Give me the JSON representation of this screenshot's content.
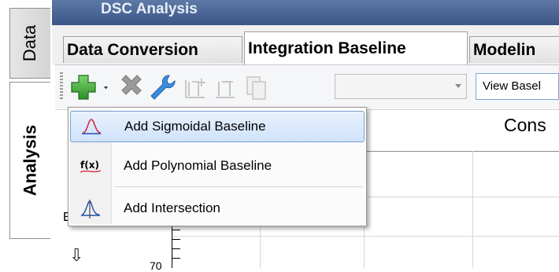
{
  "window": {
    "title": "DSC Analysis"
  },
  "side_tabs": [
    {
      "label": "Data"
    },
    {
      "label": "Analysis",
      "selected": true
    }
  ],
  "main_tabs": [
    {
      "label": "Data Conversion"
    },
    {
      "label": "Integration Baseline",
      "selected": true
    },
    {
      "label": "Modelin"
    }
  ],
  "toolbar": {
    "icons": [
      "add-icon",
      "delete-icon",
      "wrench-icon",
      "baseline-start-icon",
      "baseline-end-icon",
      "copy-icon"
    ],
    "combo_value": "",
    "view_button_label": "View Basel"
  },
  "menu": {
    "items": [
      {
        "label": "Add Sigmoidal Baseline",
        "icon": "sigmoid-icon",
        "highlighted": true
      },
      {
        "label": "Add Polynomial Baseline",
        "icon": "fx-icon"
      },
      {
        "label": "Add Intersection",
        "icon": "intersection-icon"
      }
    ]
  },
  "graph": {
    "title": "Cons",
    "side_letter": "E",
    "tick_label": "70"
  },
  "colors": {
    "title_bar": "#4a6598",
    "menu_highlight": "#cfe2fb",
    "add_icon": "#3aa53a",
    "delete_icon": "#8f8f8f",
    "wrench_icon": "#2f7fd7"
  }
}
